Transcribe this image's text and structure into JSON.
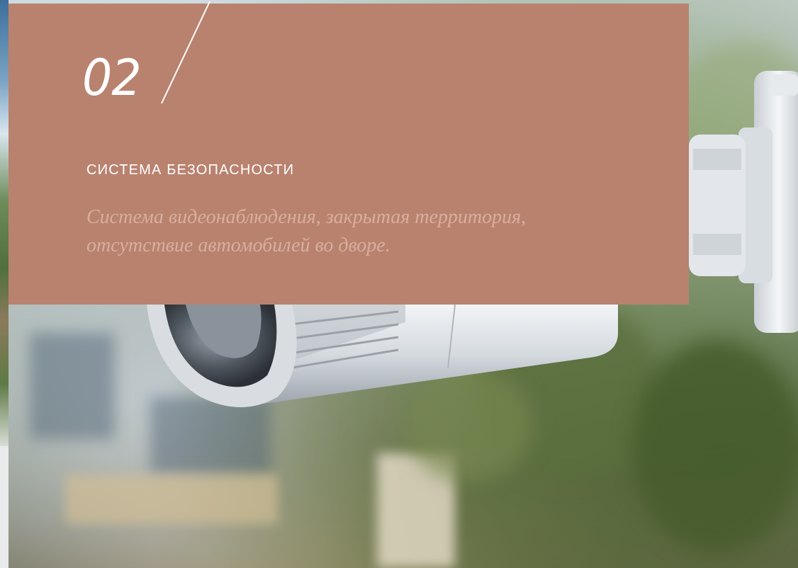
{
  "feature": {
    "number": "02",
    "title": "СИСТЕМА БЕЗОПАСНОСТИ",
    "description": "Система видеонаблюдения, закрытая территория, отсутствие автомобилей во дворе."
  },
  "colors": {
    "card_background": "#b9826f",
    "title_text": "#ffffff",
    "description_text": "#d8ae9e"
  },
  "icons": {
    "number_divider": "slash-divider-icon"
  }
}
